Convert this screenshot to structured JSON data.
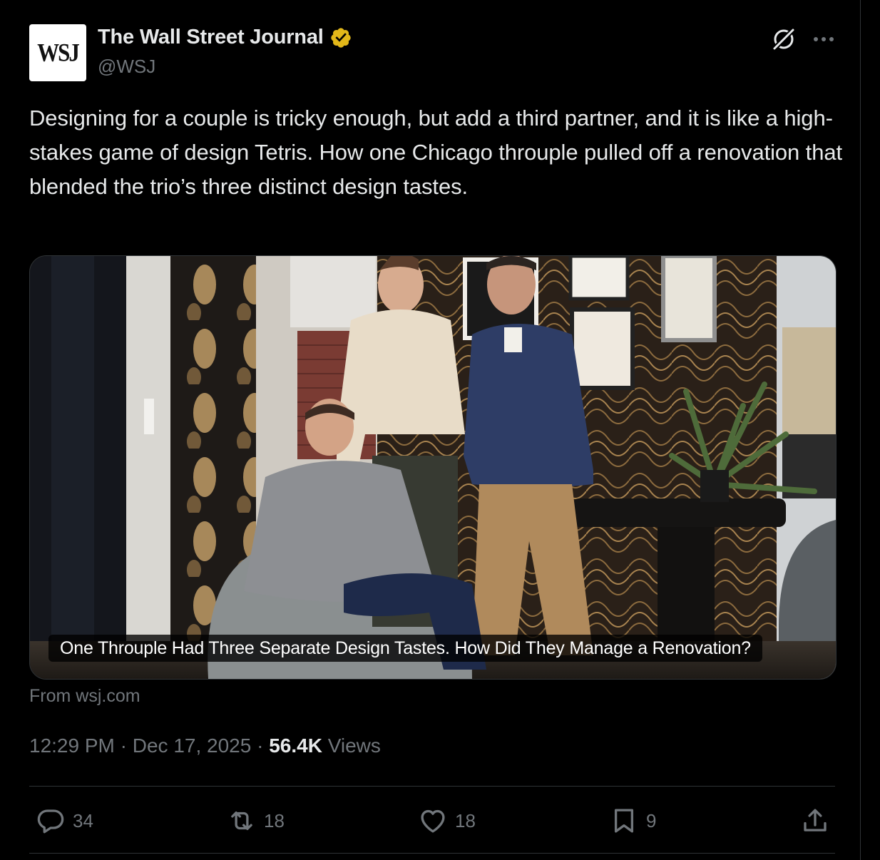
{
  "author": {
    "avatar_text": "WSJ",
    "name": "The Wall Street Journal",
    "handle": "@WSJ"
  },
  "header_icons": [
    "grok-icon",
    "more-icon"
  ],
  "tweet": {
    "text": "Designing for a couple is tricky enough, but add a third partner, and it is like a high-stakes game of design Tetris. How one Chicago throuple pulled off a renovation that blended the trio’s three distinct design tastes."
  },
  "card": {
    "headline": "One Throuple Had Three Separate Design Tastes. How Did They Manage a Renovation?",
    "source": "From wsj.com"
  },
  "meta": {
    "time": "12:29 PM",
    "separator": "·",
    "date": "Dec 17, 2025",
    "views_count": "56.4K",
    "views_label": "Views"
  },
  "actions": {
    "replies": "34",
    "reposts": "18",
    "likes": "18",
    "bookmarks": "9"
  },
  "colors": {
    "background": "#000000",
    "text_primary": "#e7e9ea",
    "text_secondary": "#71767b",
    "border": "#2f3336",
    "verified_gold": "#e2b719"
  }
}
